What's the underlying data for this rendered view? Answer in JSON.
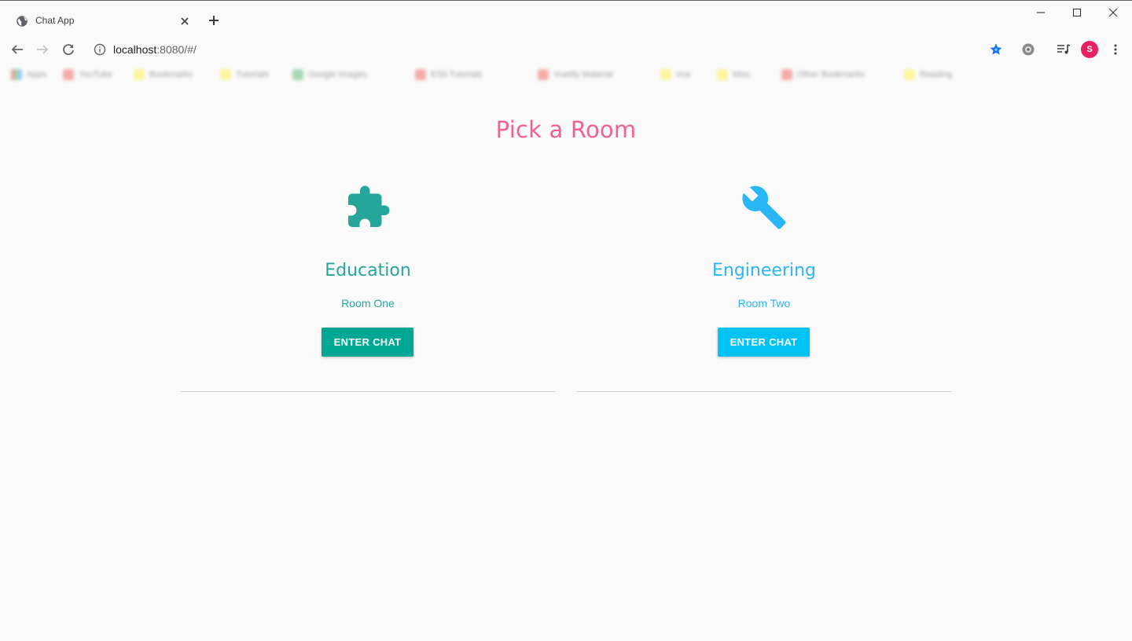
{
  "browser": {
    "tab_title": "Chat App",
    "url_host": "localhost",
    "url_rest": ":8080/#/",
    "profile_initial": "S",
    "bookmarks": [
      {
        "label": "Apps",
        "color": "#cfcfcf"
      },
      {
        "label": "YouTube",
        "color": "#f28b82"
      },
      {
        "label": "Bookmarks",
        "color": "#fff475"
      },
      {
        "label": "Tutorials",
        "color": "#fff475"
      },
      {
        "label": "Google Images",
        "color": "#81c995"
      },
      {
        "label": "ES6 Tutorials",
        "color": "#f28b82"
      },
      {
        "label": "Vuetify Material",
        "color": "#f28b82"
      },
      {
        "label": "Vue",
        "color": "#fff475"
      },
      {
        "label": "Misc",
        "color": "#fff475"
      },
      {
        "label": "Other Bookmarks",
        "color": "#f28b82"
      },
      {
        "label": "Reading",
        "color": "#fff475"
      }
    ]
  },
  "page": {
    "title": "Pick a Room",
    "title_color": "#f06292",
    "rooms": [
      {
        "name": "Education",
        "subtitle": "Room One",
        "button_label": "ENTER CHAT",
        "icon": "puzzle-icon",
        "color": "#26a69a",
        "button_color": "#00a894"
      },
      {
        "name": "Engineering",
        "subtitle": "Room Two",
        "button_label": "ENTER CHAT",
        "icon": "wrench-icon",
        "color": "#29b6f6",
        "button_color": "#00c2f5"
      }
    ]
  }
}
